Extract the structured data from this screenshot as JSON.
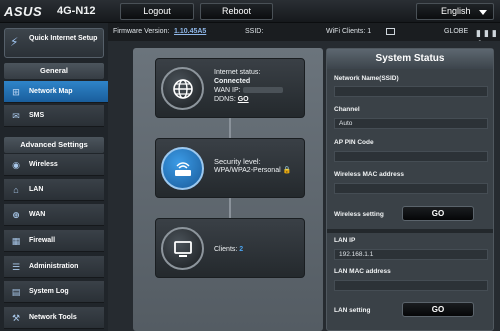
{
  "brand": {
    "logo": "ASUS",
    "model": "4G-N12"
  },
  "top_buttons": {
    "logout": "Logout",
    "reboot": "Reboot",
    "language": "English"
  },
  "info_bar": {
    "firmware_label": "Firmware Version:",
    "firmware_value": "1.10.45A5",
    "ssid_label": "SSID:",
    "wifi_clients_label": "WiFi Clients:",
    "wifi_clients_value": "1",
    "operator": "GLOBE"
  },
  "sidebar": {
    "quick_setup": "Quick Internet Setup",
    "general_head": "General",
    "general_items": [
      {
        "label": "Network Map",
        "icon": "network-map-icon",
        "active": true
      },
      {
        "label": "SMS",
        "icon": "sms-icon",
        "active": false
      }
    ],
    "advanced_head": "Advanced Settings",
    "advanced_items": [
      {
        "label": "Wireless",
        "icon": "wireless-icon"
      },
      {
        "label": "LAN",
        "icon": "lan-icon"
      },
      {
        "label": "WAN",
        "icon": "wan-icon"
      },
      {
        "label": "Firewall",
        "icon": "firewall-icon"
      },
      {
        "label": "Administration",
        "icon": "administration-icon"
      },
      {
        "label": "System Log",
        "icon": "system-log-icon"
      },
      {
        "label": "Network Tools",
        "icon": "network-tools-icon"
      }
    ]
  },
  "network_map": {
    "internet": {
      "status_label": "Internet status:",
      "status_value": "Connected",
      "wan_ip_label": "WAN IP:",
      "ddns_label": "DDNS:",
      "ddns_link": "GO"
    },
    "security": {
      "label": "Security level:",
      "value": "WPA/WPA2-Personal"
    },
    "clients": {
      "label": "Clients:",
      "count": "2"
    }
  },
  "system_status": {
    "title": "System Status",
    "network_name_label": "Network Name(SSID)",
    "channel_label": "Channel",
    "channel_value": "Auto",
    "ap_pin_label": "AP PIN Code",
    "wireless_mac_label": "Wireless MAC address",
    "wireless_setting_label": "Wireless setting",
    "go_label": "GO",
    "lan_ip_label": "LAN IP",
    "lan_ip_value": "192.168.1.1",
    "lan_mac_label": "LAN MAC address",
    "lan_setting_label": "LAN setting"
  },
  "colors": {
    "accent": "#2f84c9",
    "background": "#1e2226",
    "panel": "#3a4147"
  }
}
